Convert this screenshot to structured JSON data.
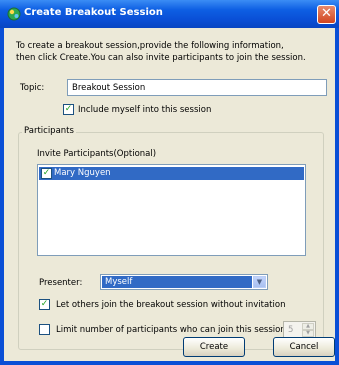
{
  "window": {
    "title": "Create Breakout Session",
    "close_icon": "close-icon"
  },
  "intro": {
    "line1": "To create a breakout session,provide the following information,",
    "line2": "then click Create.You can also invite participants to join the session."
  },
  "topic": {
    "label": "Topic:",
    "value": "Breakout Session"
  },
  "include_myself": {
    "label": "Include myself into this session",
    "checked": true
  },
  "participants": {
    "group_label": "Participants",
    "invite_label": "Invite Participants(Optional)",
    "items": [
      {
        "name": "Mary Nguyen",
        "checked": true,
        "selected": true
      }
    ]
  },
  "presenter": {
    "label": "Presenter:",
    "value": "Myself"
  },
  "let_others": {
    "label": "Let others join the breakout session without invitation",
    "checked": true
  },
  "limit": {
    "label": "Limit number of participants who can join this session:",
    "checked": false,
    "value": "5"
  },
  "buttons": {
    "create": "Create",
    "cancel": "Cancel"
  },
  "colors": {
    "title_bar": "#0a4fd6",
    "selection": "#316ac5",
    "dialog_bg": "#ece9d8",
    "close_button": "#d1451f"
  }
}
